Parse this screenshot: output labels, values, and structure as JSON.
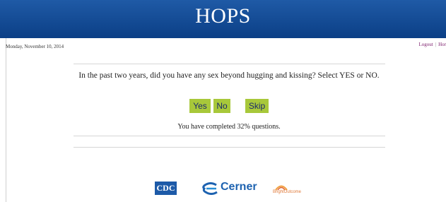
{
  "header": {
    "title": "HOPS"
  },
  "date": "Monday, November 10, 2014",
  "top_links": {
    "logout": "Logout",
    "separator": "|",
    "home": "Hor"
  },
  "question": "In the past two years, did you have any sex beyond hugging and kissing? Select YES or NO.",
  "answers": {
    "yes": "Yes",
    "no": "No",
    "skip": "Skip"
  },
  "progress_text": "You have completed 32% questions.",
  "logos": {
    "cdc": "CDC",
    "cerner": "Cerner",
    "brightoutcome": "BrightOutcome"
  },
  "colors": {
    "header": "#0b3f86",
    "button": "#a8c83a",
    "link": "#7a1a6a"
  }
}
